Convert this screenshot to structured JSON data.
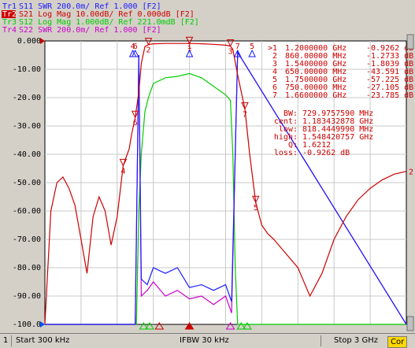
{
  "traces": [
    {
      "id": "Tr1",
      "param": "S11",
      "format": "SWR",
      "scale": "200.0m/",
      "ref": "Ref 1.000",
      "tag": "[F2]",
      "color": "#1a1aff"
    },
    {
      "id": "Tr2",
      "param": "S21",
      "format": "Log Mag",
      "scale": "10.00dB/",
      "ref": "Ref 0.000dB",
      "tag": "[F2]",
      "color": "#cc0000",
      "active": true
    },
    {
      "id": "Tr3",
      "param": "S12",
      "format": "Log Mag",
      "scale": "1.000dB/",
      "ref": "Ref 221.0mdB",
      "tag": "[F2]",
      "color": "#00cc00"
    },
    {
      "id": "Tr4",
      "param": "S22",
      "format": "SWR",
      "scale": "200.0m/",
      "ref": "Ref 1.000",
      "tag": "[F2]",
      "color": "#cc00cc"
    }
  ],
  "markers": [
    {
      "label": ">1",
      "freq": "1.2000000 GHz",
      "value": "-0.9262 dB"
    },
    {
      "label": "2",
      "freq": "860.00000 MHz",
      "value": "-1.2733 dB"
    },
    {
      "label": "3",
      "freq": "1.5400000 GHz",
      "value": "-1.8039 dB"
    },
    {
      "label": "4",
      "freq": "650.00000 MHz",
      "value": "-43.591 dB"
    },
    {
      "label": "5",
      "freq": "1.7500000 GHz",
      "value": "-57.225 dB"
    },
    {
      "label": "6",
      "freq": "750.00000 MHz",
      "value": "-27.105 dB"
    },
    {
      "label": "7",
      "freq": "1.6600000 GHz",
      "value": "-23.785 dB"
    }
  ],
  "bandwidth": {
    "bw_label": "BW:",
    "bw": "729.9757590 MHz",
    "cent_label": "cent:",
    "cent": "1.183432878 GHz",
    "low_label": "low:",
    "low": "818.4449990 MHz",
    "high_label": "high:",
    "high": "1.548420757 GHz",
    "q_label": "Q:",
    "q": "1.6212",
    "loss_label": "loss:",
    "loss": "-0.9262 dB"
  },
  "y_axis_labels": [
    "0.000",
    "-10.00",
    "-20.00",
    "-30.00",
    "-40.00",
    "-50.00",
    "-60.00",
    "-70.00",
    "-80.00",
    "-90.00",
    "-100.0"
  ],
  "status": {
    "channel": "1",
    "start": "Start 300 kHz",
    "ifbw": "IFBW 30 kHz",
    "stop": "Stop 3 GHz",
    "cor": "Cor"
  },
  "colors": {
    "plot_bg": "#ffffff",
    "grid": "#c8c8c8",
    "s11": "#1a1aff",
    "s21": "#cc0000",
    "s12": "#00cc00",
    "s22": "#cc00cc",
    "ref_arrow": "#0055ff"
  },
  "chart_data": {
    "type": "line",
    "x_unit": "GHz",
    "x_range": [
      0.0003,
      3.0
    ],
    "y_unit": "dB",
    "ylim": [
      -100,
      0
    ],
    "grid": true,
    "series": [
      {
        "name": "S21",
        "x": [
          0.0003,
          0.05,
          0.1,
          0.15,
          0.2,
          0.25,
          0.3,
          0.35,
          0.4,
          0.45,
          0.5,
          0.55,
          0.6,
          0.65,
          0.7,
          0.72,
          0.75,
          0.78,
          0.8,
          0.83,
          0.86,
          0.9,
          1.0,
          1.1,
          1.2,
          1.3,
          1.4,
          1.5,
          1.54,
          1.56,
          1.6,
          1.66,
          1.7,
          1.75,
          1.8,
          1.85,
          1.9,
          2.0,
          2.1,
          2.2,
          2.3,
          2.4,
          2.5,
          2.6,
          2.7,
          2.8,
          2.9,
          3.0
        ],
        "y": [
          -100,
          -60,
          -50,
          -48,
          -52,
          -58,
          -70,
          -82,
          -62,
          -55,
          -60,
          -72,
          -62,
          -44,
          -38,
          -33,
          -27,
          -18,
          -8,
          -2,
          -1.3,
          -1.0,
          -0.9,
          -0.9,
          -0.9,
          -1.0,
          -1.2,
          -1.5,
          -1.8,
          -3,
          -12,
          -24,
          -40,
          -57,
          -65,
          -68,
          -70,
          -75,
          -80,
          -90,
          -82,
          -70,
          -62,
          -56,
          -52,
          -49,
          -47,
          -46
        ]
      },
      {
        "name": "S12",
        "x": [
          0.0003,
          0.76,
          0.78,
          0.8,
          0.83,
          0.86,
          0.9,
          1.0,
          1.1,
          1.2,
          1.3,
          1.4,
          1.5,
          1.54,
          1.56,
          1.58,
          1.6,
          3.0
        ],
        "y": [
          -100,
          -100,
          -60,
          -40,
          -25,
          -20,
          -15,
          -13,
          -12.5,
          -11.5,
          -13,
          -16,
          -19,
          -21,
          -40,
          -80,
          -100,
          -100
        ]
      },
      {
        "name": "S11",
        "x": [
          0.0003,
          0.75,
          0.78,
          0.8,
          0.85,
          0.9,
          1.0,
          1.1,
          1.2,
          1.3,
          1.4,
          1.5,
          1.55,
          1.6,
          3.0
        ],
        "y": [
          -100,
          -100,
          -5,
          -84,
          -86,
          -80,
          -82,
          -80,
          -87,
          -86,
          -88,
          -86,
          -92,
          -4,
          -100
        ]
      },
      {
        "name": "S22",
        "x": [
          0.0003,
          0.75,
          0.78,
          0.8,
          0.85,
          0.9,
          1.0,
          1.1,
          1.2,
          1.3,
          1.4,
          1.5,
          1.55,
          1.6,
          3.0
        ],
        "y": [
          -100,
          -100,
          -5,
          -90,
          -88,
          -85,
          -90,
          -88,
          -91,
          -90,
          -93,
          -90,
          -96,
          -4,
          -100
        ]
      }
    ]
  }
}
